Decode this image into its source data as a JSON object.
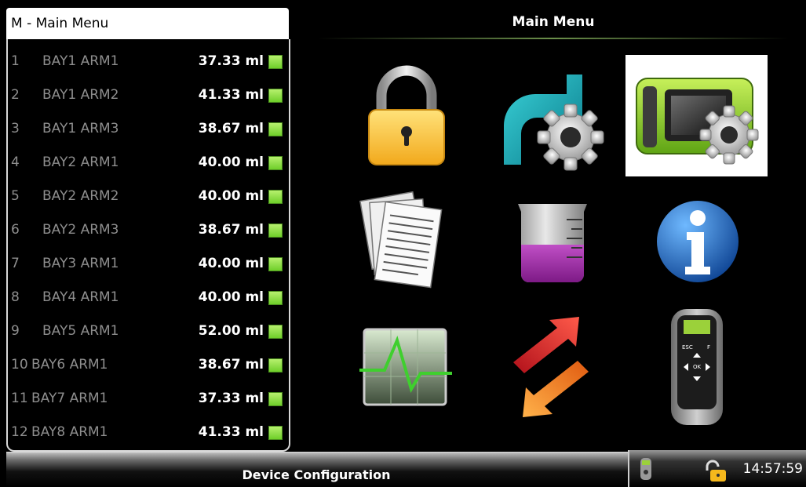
{
  "sidebar": {
    "title": "M - Main Menu",
    "items": [
      {
        "num": "1",
        "name": "BAY1 ARM1",
        "value": "37.33 ml"
      },
      {
        "num": "2",
        "name": "BAY1 ARM2",
        "value": "41.33 ml"
      },
      {
        "num": "3",
        "name": "BAY1 ARM3",
        "value": "38.67 ml"
      },
      {
        "num": "4",
        "name": "BAY2 ARM1",
        "value": "40.00 ml"
      },
      {
        "num": "5",
        "name": "BAY2 ARM2",
        "value": "40.00 ml"
      },
      {
        "num": "6",
        "name": "BAY2 ARM3",
        "value": "38.67 ml"
      },
      {
        "num": "7",
        "name": "BAY3 ARM1",
        "value": "40.00 ml"
      },
      {
        "num": "8",
        "name": "BAY4 ARM1",
        "value": "40.00 ml"
      },
      {
        "num": "9",
        "name": "BAY5 ARM1",
        "value": "52.00 ml"
      },
      {
        "num": "10",
        "name": "BAY6 ARM1",
        "value": "38.67 ml"
      },
      {
        "num": "11",
        "name": "BAY7 ARM1",
        "value": "37.33 ml"
      },
      {
        "num": "12",
        "name": "BAY8 ARM1",
        "value": "41.33 ml"
      }
    ],
    "status_color": "#7ad63a"
  },
  "main": {
    "title": "Main Menu",
    "icons": [
      "padlock-icon",
      "pipe-settings-icon",
      "device-settings-icon",
      "documents-icon",
      "beaker-icon",
      "info-icon",
      "signal-monitor-icon",
      "transfer-arrows-icon",
      "remote-control-icon"
    ],
    "selected_icon": "device-settings-icon",
    "remote_keys": {
      "esc": "ESC",
      "f": "F",
      "ok": "OK"
    }
  },
  "status": {
    "text": "Device Configuration",
    "time": "14:57:59"
  }
}
